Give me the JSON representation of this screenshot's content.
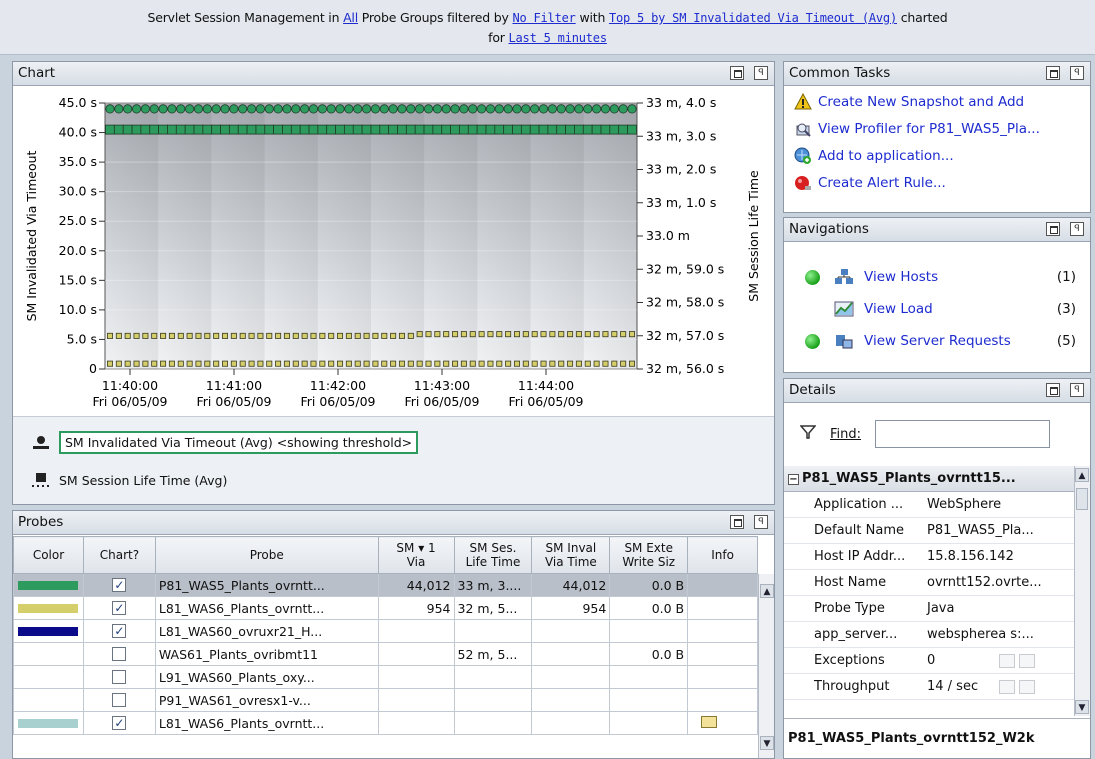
{
  "header": {
    "t1": "Servlet Session Management in ",
    "link_all": "All",
    "t2": " Probe Groups filtered by ",
    "link_filter": "No Filter",
    "t3": " with ",
    "link_top": "Top 5 by SM Invalidated Via Timeout (Avg)",
    "t4": " charted",
    "t5": "for ",
    "link_time": "Last 5 minutes"
  },
  "chart_panel": {
    "title": "Chart",
    "legend": [
      "SM Invalidated Via Timeout (Avg) <showing threshold>",
      "SM Session Life Time (Avg)"
    ]
  },
  "chart_data": {
    "type": "line",
    "left_axis_label": "SM Invalidated Via Timeout",
    "right_axis_label": "SM Session Life Time",
    "left_ticks": [
      "0",
      "5.0 s",
      "10.0 s",
      "15.0 s",
      "20.0 s",
      "25.0 s",
      "30.0 s",
      "35.0 s",
      "40.0 s",
      "45.0 s"
    ],
    "right_ticks": [
      "32 m, 56.0 s",
      "32 m, 57.0 s",
      "32 m, 58.0 s",
      "32 m, 59.0 s",
      "33.0 m",
      "33 m, 1.0 s",
      "33 m, 2.0 s",
      "33 m, 3.0 s",
      "33 m, 4.0 s"
    ],
    "x_ticks": [
      {
        "time": "11:40:00",
        "date": "Fri 06/05/09"
      },
      {
        "time": "11:41:00",
        "date": "Fri 06/05/09"
      },
      {
        "time": "11:42:00",
        "date": "Fri 06/05/09"
      },
      {
        "time": "11:43:00",
        "date": "Fri 06/05/09"
      },
      {
        "time": "11:44:00",
        "date": "Fri 06/05/09"
      }
    ],
    "ylim_left": [
      0,
      45
    ],
    "ylim_right_seconds": [
      1976,
      1984
    ],
    "series": [
      {
        "color": "#2d9a5e",
        "shape": "circle",
        "axis": "left",
        "value": 44.0
      },
      {
        "color": "#2d9a5e",
        "shape": "square",
        "axis": "right",
        "value": 1983.2
      },
      {
        "color": "#d4cf6a",
        "shape": "square",
        "axis": "left",
        "values": [
          5.6,
          5.9
        ],
        "step_after_fraction": 0.59
      },
      {
        "color": "#d4cf6a",
        "shape": "square",
        "axis": "left",
        "value": 0.9
      }
    ]
  },
  "probes_panel": {
    "title": "Probes",
    "columns": [
      "Color",
      "Chart?",
      "Probe",
      "SM ▾ 1\nVia",
      "SM Ses.\nLife Time",
      "SM Inval\nVia Time",
      "SM Exte\nWrite Siz",
      "Info"
    ],
    "rows": [
      {
        "color": "#2d9a5e",
        "checked": true,
        "probe": "P81_WAS5_Plants_ovrntt...",
        "via": "44,012",
        "life": "33 m, 3....",
        "inval": "44,012",
        "write": "0.0 B",
        "selected": true
      },
      {
        "color": "#d4cf6a",
        "checked": true,
        "probe": "L81_WAS6_Plants_ovrntt...",
        "via": "954",
        "life": "32 m, 5...",
        "inval": "954",
        "write": "0.0 B"
      },
      {
        "color": "#0a0a8a",
        "checked": true,
        "probe": "L81_WAS60_ovruxr21_H...",
        "via": "",
        "life": "",
        "inval": "",
        "write": ""
      },
      {
        "color": "",
        "checked": false,
        "probe": "WAS61_Plants_ovribmt11",
        "via": "",
        "life": "52 m, 5...",
        "inval": "",
        "write": "0.0 B"
      },
      {
        "color": "",
        "checked": false,
        "probe": "L91_WAS60_Plants_oxy...",
        "via": "",
        "life": "",
        "inval": "",
        "write": ""
      },
      {
        "color": "",
        "checked": false,
        "probe": "P91_WAS61_ovresx1-v...",
        "via": "",
        "life": "",
        "inval": "",
        "write": ""
      },
      {
        "color": "#a8d0cf",
        "checked": true,
        "probe": "L81_WAS6_Plants_ovrntt...",
        "via": "",
        "life": "",
        "inval": "",
        "write": ""
      }
    ]
  },
  "tasks_panel": {
    "title": "Common Tasks",
    "items": [
      {
        "label": "Create New Snapshot and Add",
        "icon": "warning-icon"
      },
      {
        "label": "View Profiler for P81_WAS5_Pla...",
        "icon": "profiler-icon"
      },
      {
        "label": "Add to application...",
        "icon": "add-app-icon"
      },
      {
        "label": "Create Alert Rule...",
        "icon": "alert-icon"
      }
    ]
  },
  "nav_panel": {
    "title": "Navigations",
    "items": [
      {
        "label": "View Hosts",
        "count": "(1)",
        "dot": true
      },
      {
        "label": "View Load",
        "count": "(3)",
        "dot": false
      },
      {
        "label": "View Server Requests",
        "count": "(5)",
        "dot": true
      }
    ]
  },
  "details_panel": {
    "title": "Details",
    "find_label": "Find:",
    "group": "P81_WAS5_Plants_ovrntt15...",
    "rows": [
      {
        "key": "Application ...",
        "value": "WebSphere"
      },
      {
        "key": "Default Name",
        "value": "P81_WAS5_Pla..."
      },
      {
        "key": "Host IP Addr...",
        "value": "15.8.156.142"
      },
      {
        "key": "Host Name",
        "value": "ovrntt152.ovrte..."
      },
      {
        "key": "Probe Type",
        "value": "Java"
      },
      {
        "key": "app_server...",
        "value": "webspherea s:..."
      },
      {
        "key": "Exceptions",
        "value": "0"
      },
      {
        "key": "Throughput",
        "value": "14 / sec"
      }
    ],
    "footer": "P81_WAS5_Plants_ovrntt152_W2k"
  }
}
